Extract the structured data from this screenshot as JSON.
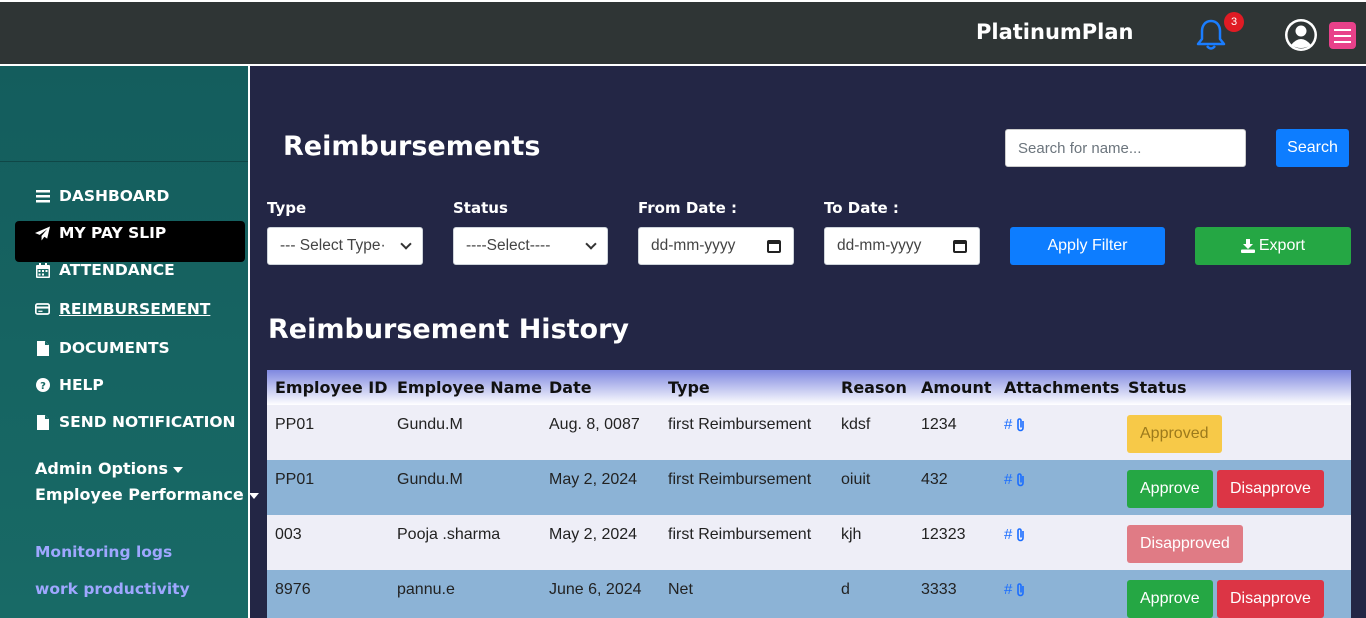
{
  "header": {
    "brand": "PlatinumPlan",
    "notification_count": "3",
    "icons": [
      "bell-icon",
      "user-circle-icon",
      "hamburger-menu-icon"
    ]
  },
  "sidebar": {
    "items": [
      {
        "label": "DASHBOARD",
        "icon": "list-icon"
      },
      {
        "label": "MY PAY SLIP",
        "icon": "paper-plane-icon"
      },
      {
        "label": "ATTENDANCE",
        "icon": "calendar-icon"
      },
      {
        "label": "REIMBURSEMENT",
        "icon": "credit-card-icon",
        "active": true
      },
      {
        "label": "DOCUMENTS",
        "icon": "file-icon"
      },
      {
        "label": "HELP",
        "icon": "question-circle-icon"
      },
      {
        "label": "SEND NOTIFICATION",
        "icon": "file-icon"
      }
    ],
    "dropdowns": [
      "Admin Options",
      "Employee Performance"
    ],
    "links": [
      "Monitoring logs",
      "work productivity"
    ]
  },
  "main": {
    "title": "Reimbursements",
    "search": {
      "placeholder": "Search for name...",
      "button": "Search"
    },
    "filters": {
      "type_label": "Type",
      "type_value": "--- Select Type·",
      "status_label": "Status",
      "status_value": "----Select----",
      "from_label": "From Date :",
      "from_value": "dd-mm-yyyy",
      "to_label": "To Date :",
      "to_value": "dd-mm-yyyy",
      "apply": "Apply Filter",
      "export": "Export"
    },
    "history_title": "Reimbursement History",
    "table": {
      "headers": [
        "Employee ID",
        "Employee Name",
        "Date",
        "Type",
        "Reason",
        "Amount",
        "Attachments",
        "Status"
      ],
      "rows": [
        {
          "id": "PP01",
          "name": "Gundu.M",
          "date": "Aug. 8, 0087",
          "type": "first Reimbursement",
          "reason": "kdsf",
          "amount": "1234",
          "attach": "#",
          "status": "Approved"
        },
        {
          "id": "PP01",
          "name": "Gundu.M",
          "date": "May 2, 2024",
          "type": "first Reimbursement",
          "reason": "oiuit",
          "amount": "432",
          "attach": "#",
          "approve": "Approve",
          "disapprove": "Disapprove"
        },
        {
          "id": "003",
          "name": "Pooja .sharma",
          "date": "May 2, 2024",
          "type": "first Reimbursement",
          "reason": "kjh",
          "amount": "12323",
          "attach": "#",
          "status": "Disapproved"
        },
        {
          "id": "8976",
          "name": "pannu.e",
          "date": "June 6, 2024",
          "type": "Net",
          "reason": "d",
          "amount": "3333",
          "attach": "#",
          "approve": "Approve",
          "disapprove": "Disapprove"
        }
      ]
    }
  },
  "colors": {
    "accent": "#0d7dff",
    "success": "#25a744",
    "danger": "#dc3545",
    "warning": "#f7c948",
    "sidebar": "#145d5d",
    "main_bg": "#232645"
  }
}
